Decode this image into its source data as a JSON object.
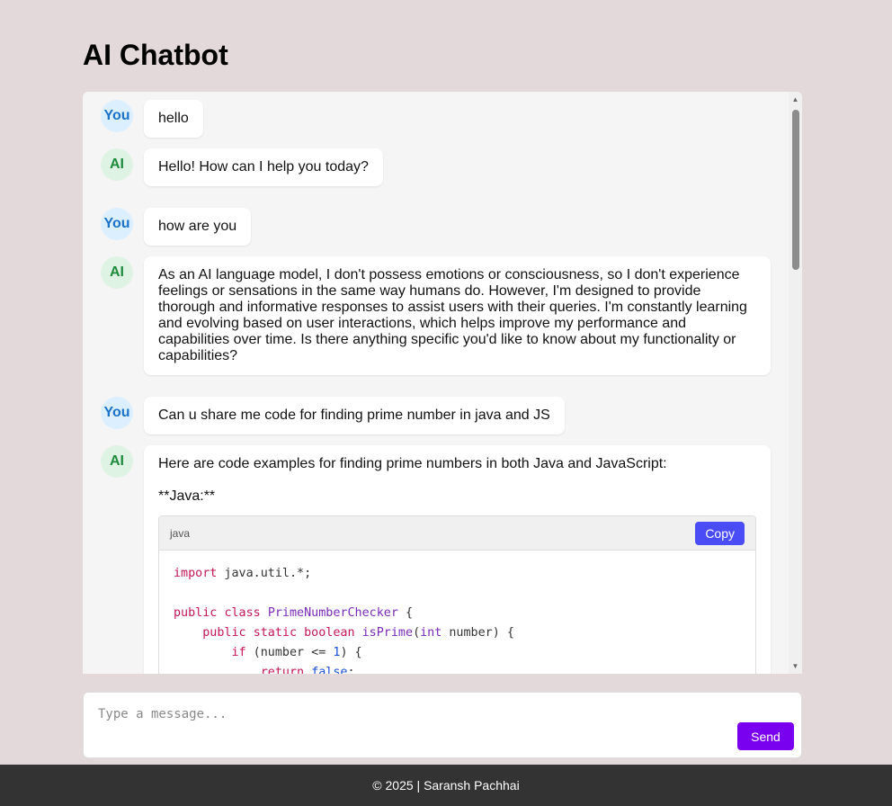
{
  "app": {
    "title": "AI Chatbot"
  },
  "messages": [
    {
      "sender": "You",
      "text": "hello"
    },
    {
      "sender": "AI",
      "text": "Hello! How can I help you today?"
    },
    {
      "sender": "You",
      "text": "how are you"
    },
    {
      "sender": "AI",
      "text": "As an AI language model, I don't possess emotions or consciousness, so I don't experience feelings or sensations in the same way humans do. However, I'm designed to provide thorough and informative responses to assist users with their queries. I'm constantly learning and evolving based on user interactions, which helps improve my performance and capabilities over time. Is there anything specific you'd like to know about my functionality or capabilities?"
    },
    {
      "sender": "You",
      "text": "Can u share me code for finding prime number in java and JS"
    },
    {
      "sender": "AI",
      "text": "Here are code examples for finding prime numbers in both Java and JavaScript:",
      "subheading": "**Java:**",
      "code": {
        "language": "java",
        "copy_label": "Copy"
      }
    }
  ],
  "composer": {
    "placeholder": "Type a message...",
    "send_label": "Send"
  },
  "footer": {
    "text": "© 2025 | Saransh Pachhai"
  },
  "colors": {
    "background": "#e3d8da",
    "send_button": "#7a00f0",
    "copy_button": "#4a4cf5",
    "footer": "#333333"
  }
}
